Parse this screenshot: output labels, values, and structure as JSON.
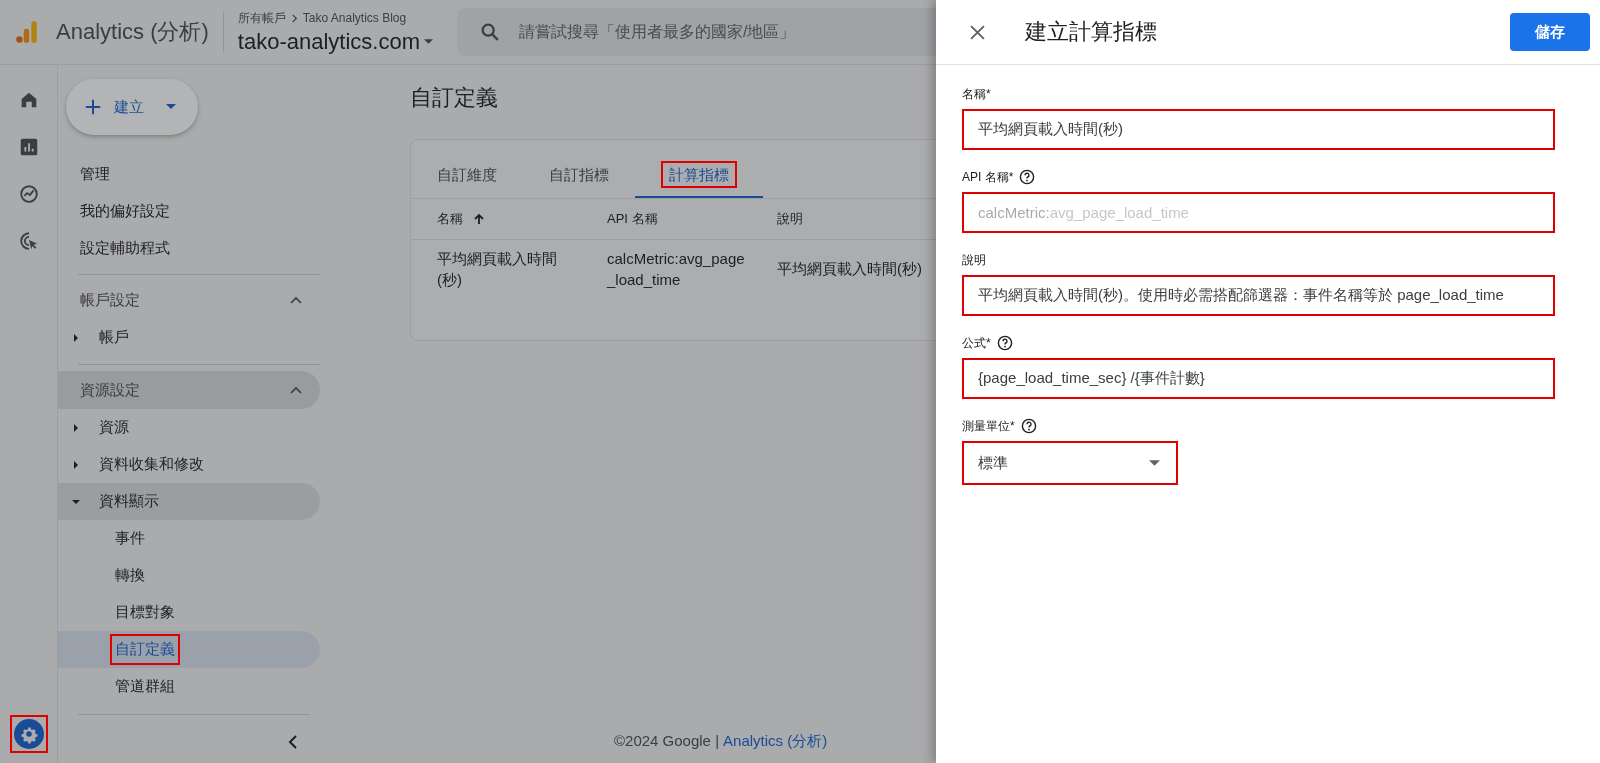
{
  "header": {
    "product": "Analytics (分析)",
    "breadcrumb": [
      "所有帳戶",
      "Tako Analytics Blog"
    ],
    "property": "tako-analytics.com",
    "search": {
      "placeholder": "請嘗試搜尋「使用者最多的國家/地區」"
    }
  },
  "rail": {
    "admin": {
      "selected": true,
      "highlighted": true
    }
  },
  "nav": {
    "create_button": "建立",
    "items": [
      {
        "kind": "link",
        "label": "管理"
      },
      {
        "kind": "link",
        "label": "我的偏好設定"
      },
      {
        "kind": "link",
        "label": "設定輔助程式"
      },
      {
        "kind": "divider"
      },
      {
        "kind": "section",
        "label": "帳戶設定",
        "expanded": true,
        "hovered": false
      },
      {
        "kind": "tree",
        "label": "帳戶",
        "expanded": false
      },
      {
        "kind": "divider"
      },
      {
        "kind": "section",
        "label": "資源設定",
        "expanded": true,
        "hovered": true
      },
      {
        "kind": "tree",
        "label": "資源",
        "expanded": false
      },
      {
        "kind": "tree",
        "label": "資料收集和修改",
        "expanded": false
      },
      {
        "kind": "tree",
        "label": "資料顯示",
        "expanded": true,
        "children": [
          {
            "label": "事件",
            "selected": false,
            "highlighted": false
          },
          {
            "label": "轉換",
            "selected": false,
            "highlighted": false
          },
          {
            "label": "目標對象",
            "selected": false,
            "highlighted": false
          },
          {
            "label": "自訂定義",
            "selected": true,
            "highlighted": true
          },
          {
            "label": "管道群組",
            "selected": false,
            "highlighted": false
          }
        ]
      }
    ]
  },
  "main": {
    "title": "自訂定義",
    "tabs": [
      {
        "label": "自訂維度",
        "selected": false,
        "highlighted": false
      },
      {
        "label": "自訂指標",
        "selected": false,
        "highlighted": false
      },
      {
        "label": "計算指標",
        "selected": true,
        "highlighted": true
      }
    ],
    "table": {
      "columns": [
        {
          "label": "名稱",
          "sorted": true
        },
        {
          "label": "API 名稱",
          "sorted": false
        },
        {
          "label": "說明",
          "sorted": false
        }
      ],
      "rows": [
        [
          "平均網頁載入時間(秒)",
          "calcMetric:avg_page_load_time",
          "平均網頁載入時間(秒)"
        ]
      ]
    },
    "footer": {
      "text": "©2024 Google |",
      "link": "Analytics (分析)"
    }
  },
  "drawer": {
    "title": "建立計算指標",
    "save_button": "儲存",
    "fields": [
      {
        "kind": "text",
        "label": "名稱*",
        "help": false,
        "value": "平均網頁載入時間(秒)",
        "highlighted": true
      },
      {
        "kind": "text",
        "label": "API 名稱*",
        "help": true,
        "prefix": "calcMetric:",
        "placeholder": "avg_page_load_time",
        "highlighted": true
      },
      {
        "kind": "text",
        "label": "說明",
        "help": false,
        "value": "平均網頁載入時間(秒)。使用時必需搭配篩選器：事件名稱等於 page_load_time",
        "highlighted": true
      },
      {
        "kind": "text",
        "label": "公式*",
        "help": true,
        "value": "{page_load_time_sec} /{事件計數}",
        "highlighted": true
      },
      {
        "kind": "select",
        "label": "測量單位*",
        "help": true,
        "value": "標準",
        "highlighted": true
      }
    ]
  }
}
